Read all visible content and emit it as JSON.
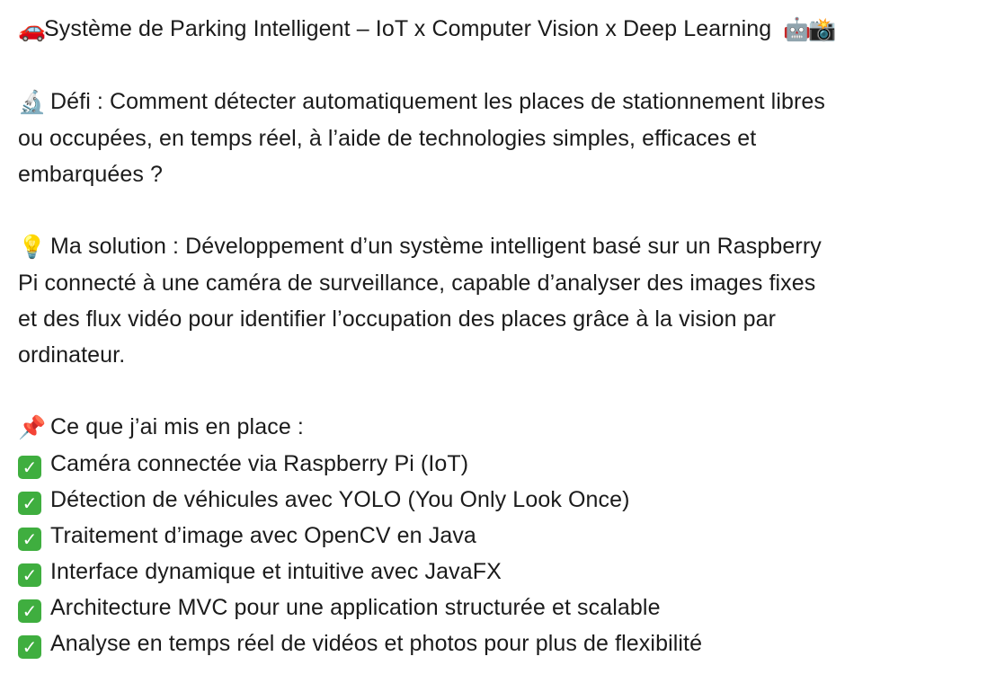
{
  "post": {
    "title_icon": "car-icon",
    "title": "Système de Parking Intelligent – IoT x Computer Vision x Deep Learning",
    "title_end_icons": [
      "robot-icon",
      "camera-flash-icon"
    ],
    "challenge": {
      "icon": "microscope-icon",
      "lines": [
        "Défi : Comment détecter automatiquement les places de stationnement libres",
        "ou occupées, en temps réel, à l’aide de technologies simples, efficaces et",
        "embarquées ?"
      ]
    },
    "solution": {
      "icon": "lightbulb-icon",
      "lines": [
        "Ma solution : Développement d’un système intelligent basé sur un Raspberry",
        "Pi connecté à une caméra de surveillance, capable d’analyser des images fixes",
        "et des flux vidéo pour identifier l’occupation des places grâce à la vision par",
        "ordinateur."
      ]
    },
    "implemented": {
      "icon": "pushpin-icon",
      "heading": "Ce que j’ai mis en place :",
      "item_icon": "check-mark-button-icon",
      "items": [
        "Caméra connectée via Raspberry Pi (IoT)",
        "Détection de véhicules avec YOLO (You Only Look Once)",
        "Traitement d’image avec OpenCV en Java",
        "Interface dynamique et intuitive avec JavaFX",
        "Architecture MVC pour une application structurée et scalable",
        "Analyse en temps réel de vidéos et photos pour plus de flexibilité"
      ]
    }
  }
}
